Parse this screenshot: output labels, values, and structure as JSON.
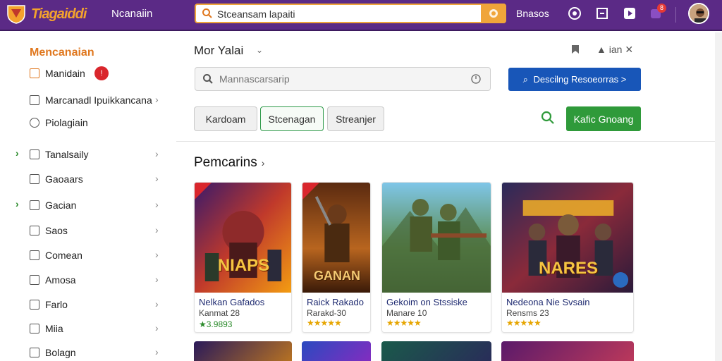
{
  "topbar": {
    "brand": "Tiagaiddi",
    "nav_label": "Ncanaiin",
    "search_value": "Stceansam lapaiti",
    "right_label": "Bnasos",
    "notification_count": "8"
  },
  "sidebar": {
    "title": "Mencanaian",
    "items": [
      {
        "label": "Manidain",
        "badge": "!"
      },
      {
        "label": "Marcanadl Ipuikkancana"
      },
      {
        "label": "Piolagiain"
      },
      {
        "label": "Tanalsaily"
      },
      {
        "label": "Gaoaars"
      },
      {
        "label": "Gacian"
      },
      {
        "label": "Saos"
      },
      {
        "label": "Comean"
      },
      {
        "label": "Amosa"
      },
      {
        "label": "Farlo"
      },
      {
        "label": "Miia"
      },
      {
        "label": "Bolagn"
      }
    ]
  },
  "main": {
    "title": "Mor Yalai",
    "header_right_label": "ian",
    "search_placeholder": "Mannascarsarip",
    "blue_button": "Descilng Resoeorras >",
    "filters": [
      "Kardoam",
      "Stcenagan",
      "Streanjer"
    ],
    "green_button": "Kafic Gnoang",
    "section_title": "Pemcarins"
  },
  "cards": [
    {
      "art_title": "NIAPS",
      "title": "Nelkan Gafados",
      "subtitle": "Kanmat 28",
      "rating": "★3.9893",
      "stars": ""
    },
    {
      "art_title": "GANAN",
      "title": "Raick Rakado",
      "subtitle": "Rarakd-30",
      "rating": "",
      "stars": "★★★★★"
    },
    {
      "art_title": "",
      "title": "Gekoim on Stssiske",
      "subtitle": "Manare 10",
      "rating": "",
      "stars": "★★★★★"
    },
    {
      "art_title": "NARES",
      "title": "Nedeona Nie Svsain",
      "subtitle": "Rensms 23",
      "rating": "",
      "stars": "★★★★★"
    }
  ],
  "colors": {
    "topbar": "#5b2a86",
    "accent_orange": "#f0a53a",
    "primary_blue": "#1856b8",
    "primary_green": "#2f9a3a"
  }
}
